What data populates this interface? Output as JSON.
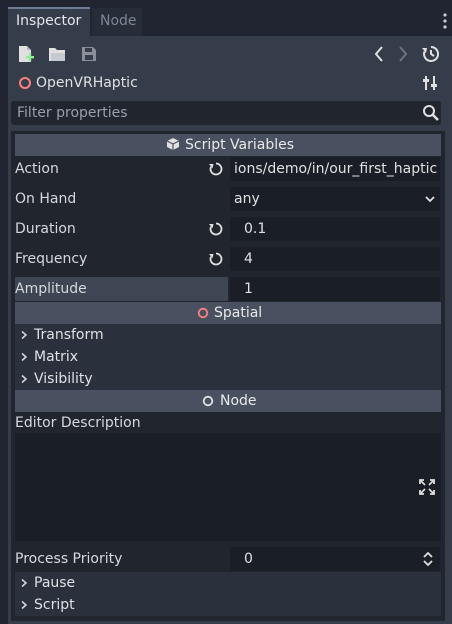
{
  "tabs": [
    {
      "label": "Inspector",
      "active": true
    },
    {
      "label": "Node",
      "active": false
    }
  ],
  "toolbar": {
    "icons": [
      "new-resource-icon",
      "open-icon",
      "save-icon",
      "history-back-icon",
      "history-forward-icon",
      "object-history-icon"
    ]
  },
  "object": {
    "name": "OpenVRHaptic",
    "icon": "spatial-node-icon",
    "tools_icon": "object-tools-icon"
  },
  "filter": {
    "placeholder": "Filter properties",
    "icon": "search-icon"
  },
  "script_variables": {
    "title": "Script Variables",
    "properties": [
      {
        "label": "Action",
        "value": "ions/demo/in/our_first_haptic",
        "reset": true
      },
      {
        "label": "On Hand",
        "value": "any",
        "dropdown": true
      },
      {
        "label": "Duration",
        "value": "0.1",
        "reset": true
      },
      {
        "label": "Frequency",
        "value": "4",
        "reset": true
      },
      {
        "label": "Amplitude",
        "value": "1",
        "highlighted": true
      }
    ]
  },
  "spatial": {
    "title": "Spatial",
    "sections": [
      "Transform",
      "Matrix",
      "Visibility"
    ]
  },
  "node": {
    "title": "Node",
    "editor_description_label": "Editor Description",
    "editor_description_value": "",
    "process_priority_label": "Process Priority",
    "process_priority_value": "0",
    "sections": [
      "Pause",
      "Script"
    ]
  },
  "colors": {
    "accent_spatial": "#fc7f7f",
    "background": "#202531",
    "panel": "#363d4a",
    "field": "#1a1e26"
  }
}
